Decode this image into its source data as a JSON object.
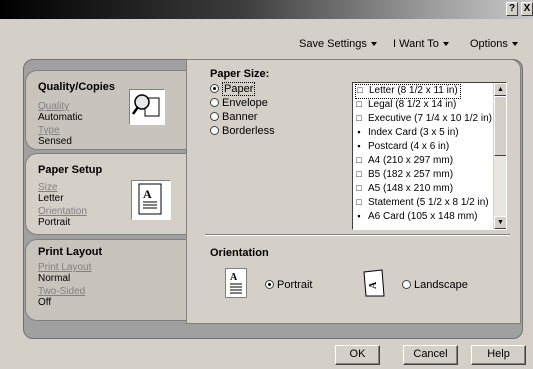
{
  "titlebar": {
    "help_label": "?",
    "close_label": "X"
  },
  "menubar": {
    "items": [
      {
        "label": "Save Settings"
      },
      {
        "label": "I Want To"
      },
      {
        "label": "Options"
      }
    ]
  },
  "tabs": {
    "quality": {
      "title": "Quality/Copies",
      "quality_label": "Quality",
      "quality_value": "Automatic",
      "type_label": "Type",
      "type_value": "Sensed"
    },
    "paper_setup": {
      "title": "Paper Setup",
      "size_label": "Size",
      "size_value": "Letter",
      "orientation_label": "Orientation",
      "orientation_value": "Portrait"
    },
    "print_layout": {
      "title": "Print Layout",
      "layout_label": "Print Layout",
      "layout_value": "Normal",
      "two_sided_label": "Two-Sided",
      "two_sided_value": "Off"
    }
  },
  "paper_size": {
    "title": "Paper Size:",
    "options": [
      {
        "label": "Paper",
        "selected": true
      },
      {
        "label": "Envelope",
        "selected": false
      },
      {
        "label": "Banner",
        "selected": false
      },
      {
        "label": "Borderless",
        "selected": false
      }
    ],
    "list": [
      {
        "label": "Letter (8 1/2 x 11 in)",
        "icon": "page-icon",
        "selected": true
      },
      {
        "label": "Legal (8 1/2  x 14 in)",
        "icon": "page-icon"
      },
      {
        "label": "Executive (7 1/4 x 10 1/2 in)",
        "icon": "page-icon"
      },
      {
        "label": "Index Card  (3 x 5 in)",
        "icon": "card-icon"
      },
      {
        "label": "Postcard  (4 x 6 in)",
        "icon": "card-icon"
      },
      {
        "label": "A4  (210 x 297 mm)",
        "icon": "page-icon"
      },
      {
        "label": "B5  (182 x 257 mm)",
        "icon": "page-icon"
      },
      {
        "label": "A5  (148 x 210 mm)",
        "icon": "page-icon"
      },
      {
        "label": "Statement (5 1/2 x 8 1/2 in)",
        "icon": "page-icon"
      },
      {
        "label": "A6 Card (105 x 148 mm)",
        "icon": "card-icon"
      }
    ]
  },
  "orientation": {
    "title": "Orientation",
    "portrait_label": "Portrait",
    "portrait_selected": true,
    "landscape_label": "Landscape",
    "landscape_selected": false
  },
  "buttons": {
    "ok": "OK",
    "cancel": "Cancel",
    "help": "Help"
  }
}
